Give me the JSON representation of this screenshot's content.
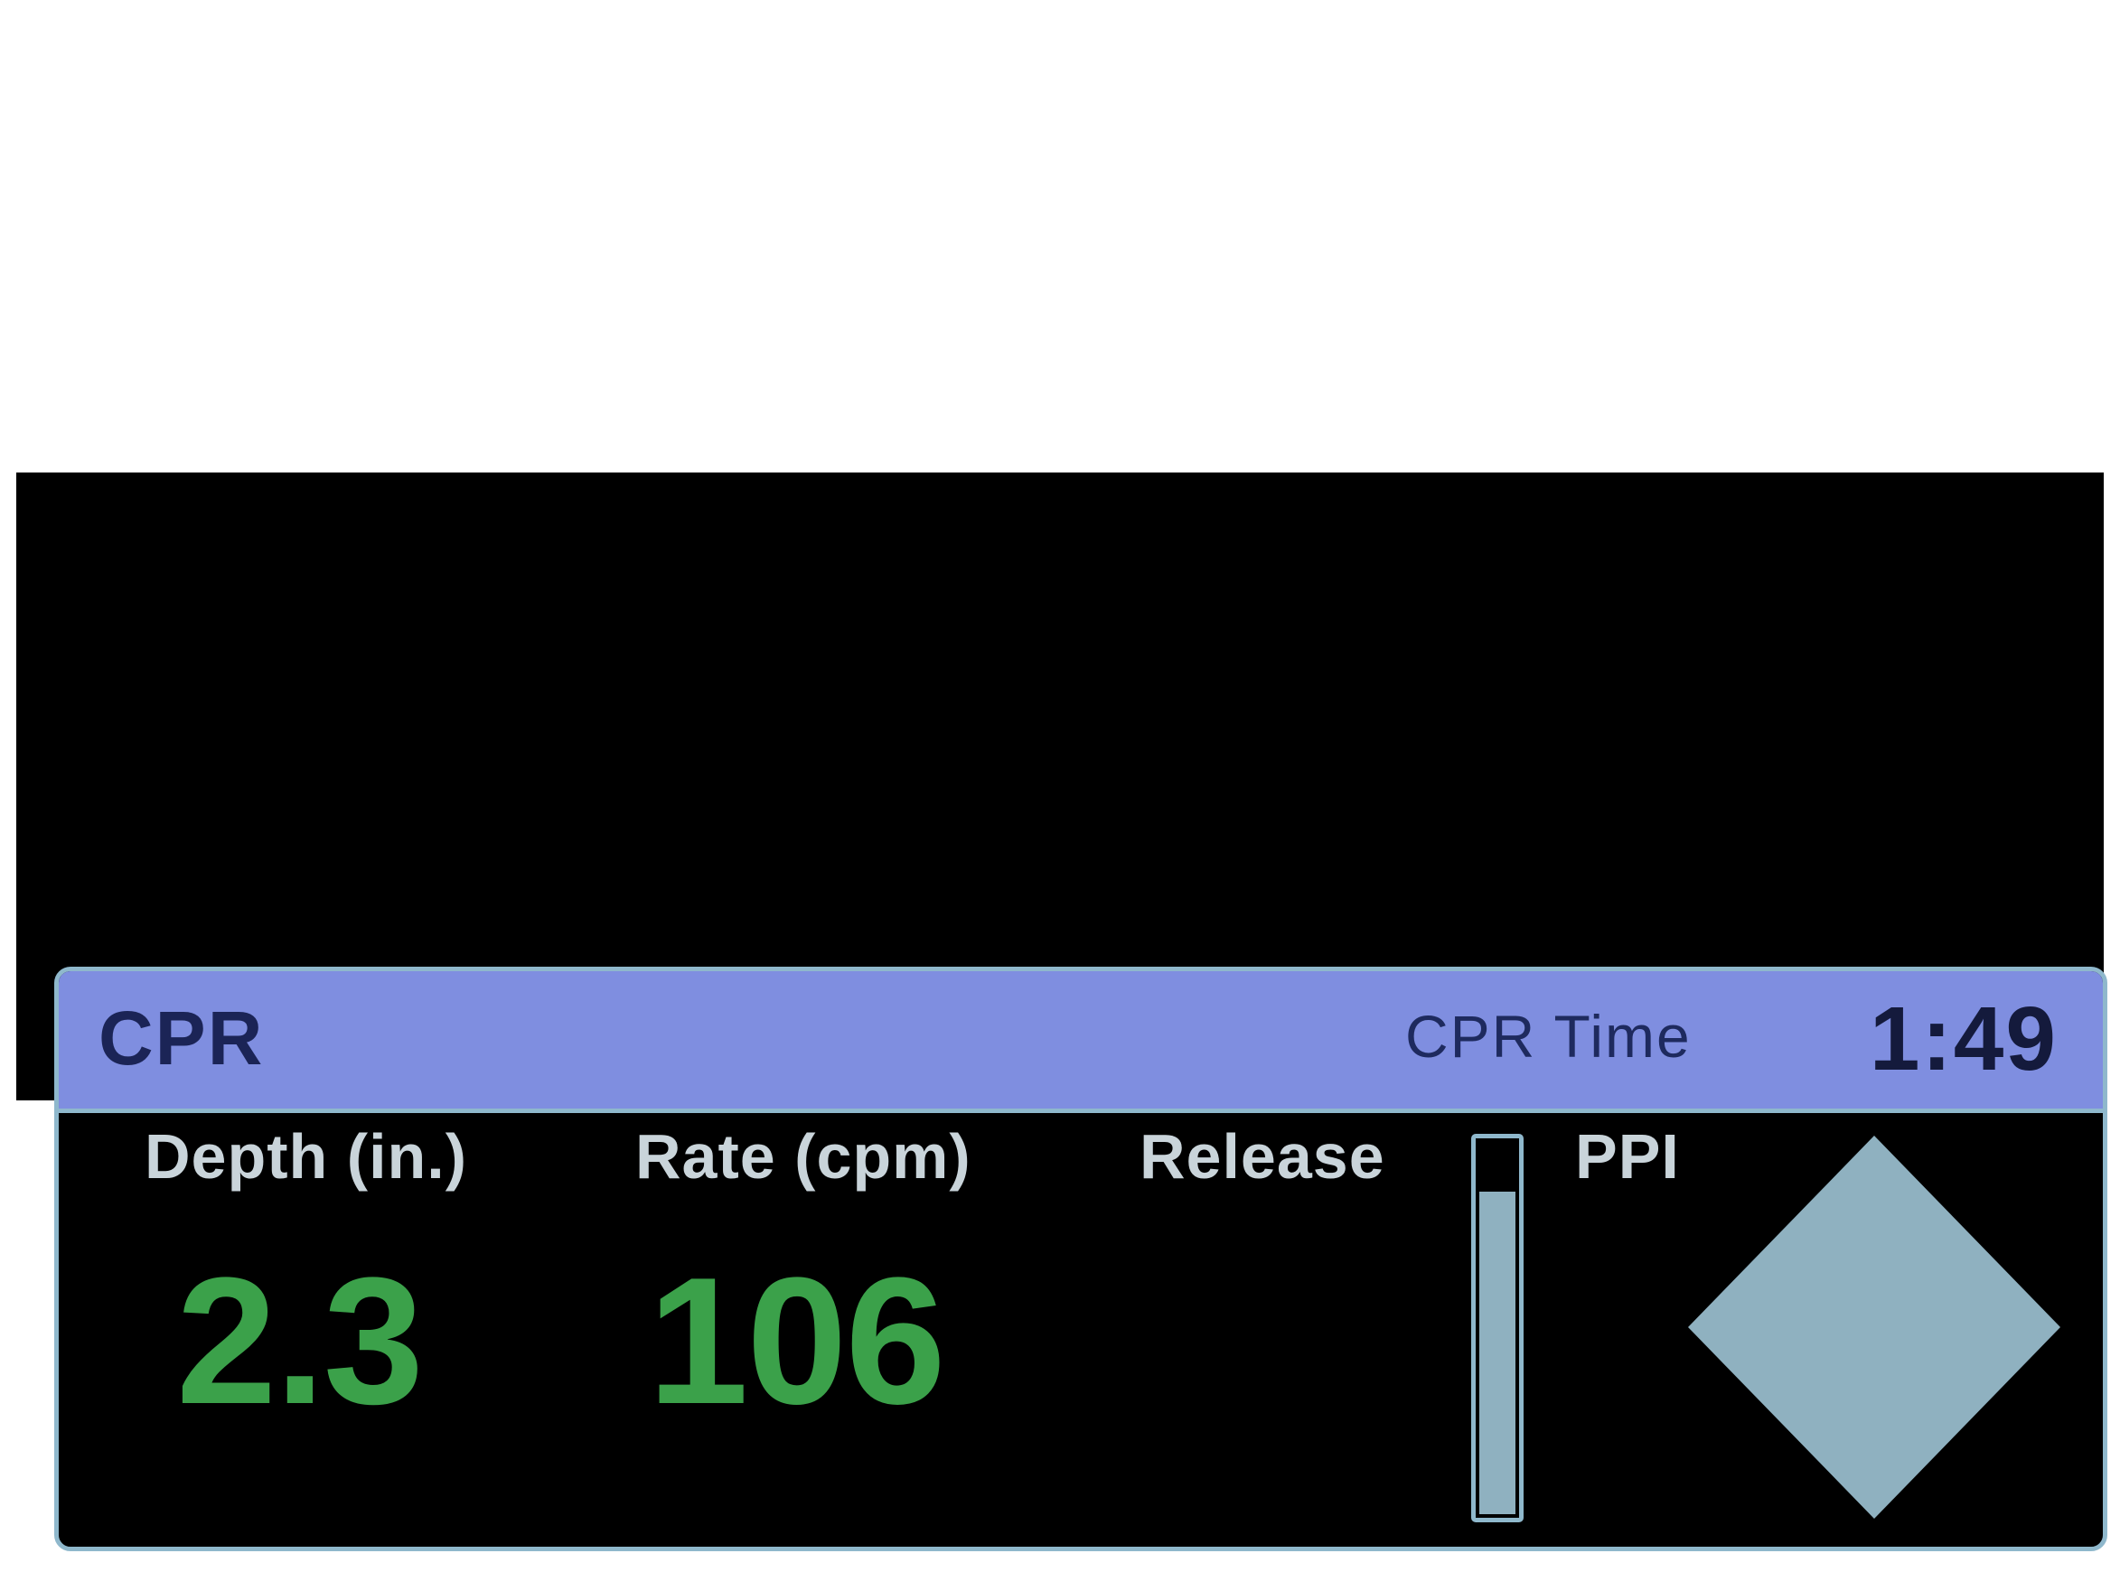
{
  "header": {
    "title": "CPR",
    "time_label": "CPR Time",
    "time_value": "1:49"
  },
  "metrics": {
    "depth_label": "Depth (in.)",
    "depth_value": "2.3",
    "rate_label": "Rate (cpm)",
    "rate_value": "106",
    "release_label": "Release",
    "ppi_label": "PPI"
  },
  "release_level": 0.87,
  "icons": {
    "ppi_indicator": "diamond-icon"
  },
  "colors": {
    "header_bg": "#7f8ee0",
    "value_green": "#3ba14a",
    "indicator": "#8fb1c0",
    "border": "#8fb8cc"
  }
}
